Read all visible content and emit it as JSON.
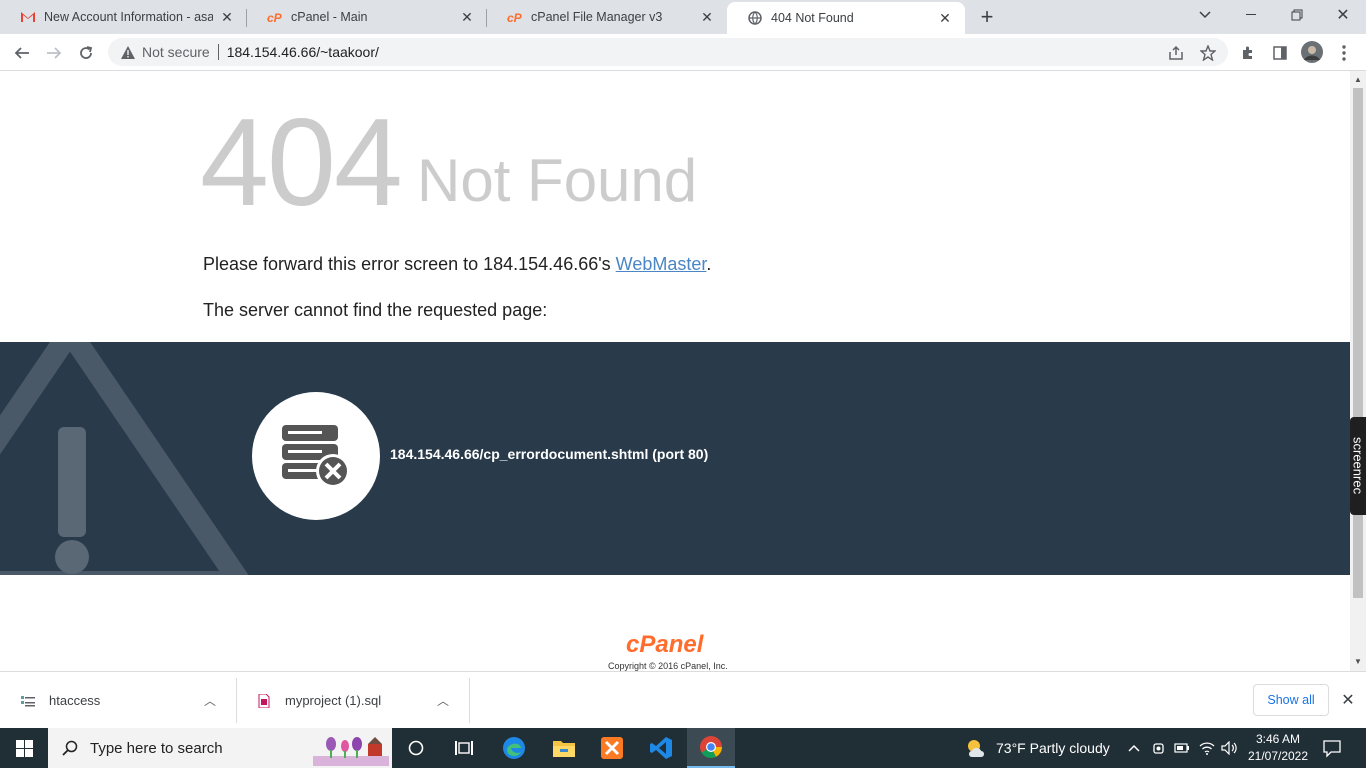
{
  "browser": {
    "tabs": [
      {
        "title": "New Account Information - asad",
        "favicon": "gmail-icon"
      },
      {
        "title": "cPanel - Main",
        "favicon": "cpanel-icon"
      },
      {
        "title": "cPanel File Manager v3",
        "favicon": "cpanel-icon"
      },
      {
        "title": "404 Not Found",
        "favicon": "globe-icon",
        "active": true
      }
    ],
    "security_label": "Not secure",
    "url": "184.154.46.66/~taakoor/"
  },
  "page": {
    "code": "404",
    "heading": "Not Found",
    "forward_text": "Please forward this error screen to 184.154.46.66's ",
    "webmaster_link": "WebMaster",
    "forward_end": ".",
    "server_text": "The server cannot find the requested page:",
    "requested_path": "184.154.46.66/cp_errordocument.shtml (port 80)",
    "logo": "cPanel",
    "copyright": "Copyright © 2016 cPanel, Inc."
  },
  "downloads": {
    "items": [
      {
        "name": "htaccess"
      },
      {
        "name": "myproject (1).sql"
      }
    ],
    "show_all": "Show all"
  },
  "taskbar": {
    "search_placeholder": "Type here to search",
    "weather": "73°F  Partly cloudy",
    "time": "3:46 AM",
    "date": "21/07/2022"
  },
  "overlay": {
    "screenrec_label": "screenrec"
  },
  "colors": {
    "band": "#293a4a",
    "cpanel_orange": "#ff6c2c",
    "link": "#4a86c5"
  }
}
